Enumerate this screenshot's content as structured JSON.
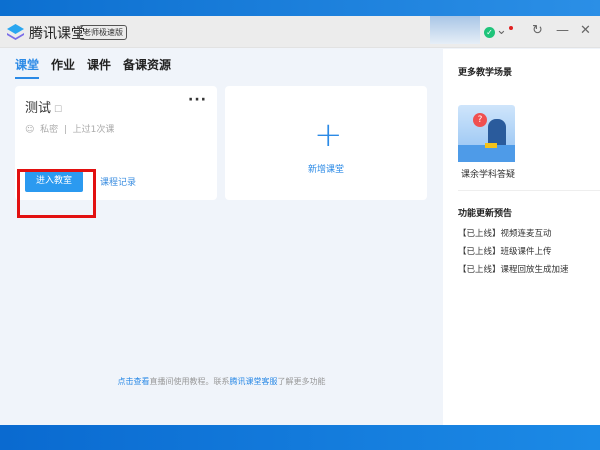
{
  "app": {
    "name": "腾讯课堂",
    "edition": "老师极速版"
  },
  "titlebar": {
    "refresh_icon": "↻",
    "minimize_icon": "—",
    "close_icon": "✕",
    "dropdown_icon": "⌄"
  },
  "tabs": [
    {
      "label": "课堂",
      "active": true
    },
    {
      "label": "作业"
    },
    {
      "label": "课件"
    },
    {
      "label": "备课资源"
    }
  ],
  "class_card": {
    "title": "测试",
    "privacy": "私密",
    "history": "上过1次课",
    "enter_label": "进入教室",
    "record_label": "课程记录"
  },
  "new_card": {
    "label": "新增课堂"
  },
  "footer": {
    "link1": "点击查看",
    "text1": "直播间使用教程。联系",
    "link2": "腾讯课堂客服",
    "text2": "了解更多功能"
  },
  "right": {
    "scenes_title": "更多教学场景",
    "scene_label": "课余学科答疑",
    "updates_title": "功能更新预告",
    "updates": [
      {
        "tag": "【已上线】",
        "text": "视频连麦互动"
      },
      {
        "tag": "【已上线】",
        "text": "班级课件上传"
      },
      {
        "tag": "【已上线】",
        "text": "课程回放生成加速"
      }
    ]
  },
  "colors": {
    "accent": "#2b8ae6",
    "highlight": "#e21010"
  }
}
